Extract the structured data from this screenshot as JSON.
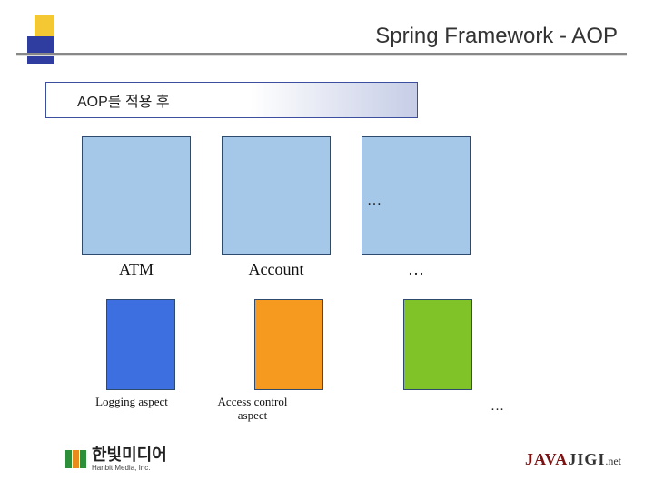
{
  "header": {
    "title": "Spring Framework - AOP"
  },
  "subtitle": "AOP를 적용 후",
  "modules": [
    {
      "label": "ATM"
    },
    {
      "label": "Account"
    },
    {
      "label": "…"
    }
  ],
  "modules_ellipsis": "…",
  "aspects": [
    {
      "label": "Logging\naspect",
      "color": "blue"
    },
    {
      "label": "Access control\naspect",
      "color": "orange"
    },
    {
      "label": "",
      "color": "green"
    }
  ],
  "aspects_ellipsis": "…",
  "footer": {
    "hanbit_name": "한빛미디어",
    "hanbit_sub": "Hanbit Media, Inc.",
    "javajigi_java": "JAVA",
    "javajigi_jigi": "JIGI",
    "javajigi_net": ".net"
  }
}
